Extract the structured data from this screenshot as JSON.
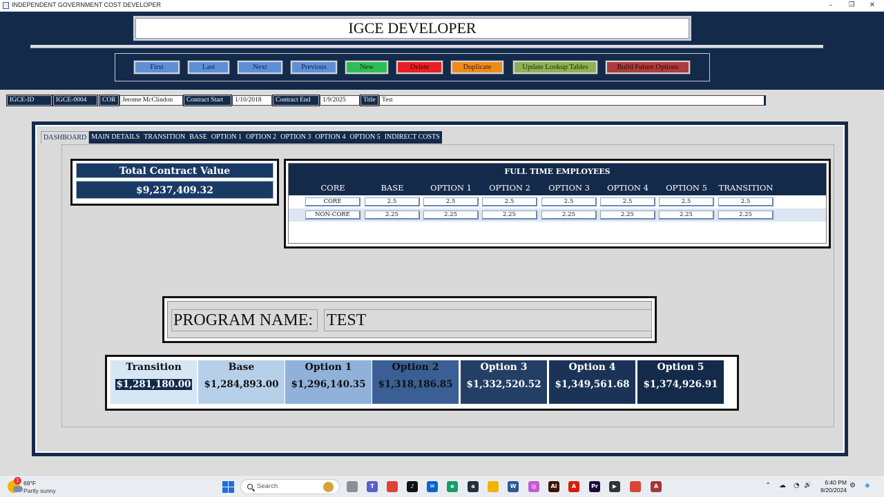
{
  "window": {
    "title": "INDEPENDENT GOVERNMENT COST DEVELOPER",
    "controls": [
      "–",
      "❐",
      "✕"
    ]
  },
  "header": {
    "title": "IGCE DEVELOPER",
    "buttons": [
      {
        "label": "First"
      },
      {
        "label": "Last"
      },
      {
        "label": "Next"
      },
      {
        "label": "Previous"
      },
      {
        "label": "New"
      },
      {
        "label": "Delete"
      },
      {
        "label": "Duplicate"
      },
      {
        "label": "Update Lookup Tables"
      },
      {
        "label": "Build Future Options"
      }
    ]
  },
  "record": {
    "igce_id_label": "IGCE-ID",
    "igce_id_value": "IGCE-0004",
    "cor_label": "COR",
    "cor_value": "Jerome McClindon",
    "contract_start_label": "Contract Start",
    "contract_start_value": "1/10/2018",
    "contract_end_label": "Contract End",
    "contract_end_value": "1/9/2025",
    "title_label": "Title",
    "title_value": "Test"
  },
  "tabs": [
    {
      "label": "DASHBOARD",
      "active": true
    },
    {
      "label": "MAIN DETAILS"
    },
    {
      "label": "TRANSITION"
    },
    {
      "label": "BASE"
    },
    {
      "label": "OPTION 1"
    },
    {
      "label": "OPTION 2"
    },
    {
      "label": "OPTION 3"
    },
    {
      "label": "OPTION 4"
    },
    {
      "label": "OPTION 5"
    },
    {
      "label": "INDIRECT COSTS"
    }
  ],
  "dashboard": {
    "total_contract_value_label": "Total Contract Value",
    "total_contract_value": "$9,237,409.32",
    "fte": {
      "title": "FULL TIME EMPLOYEES",
      "columns": [
        "CORE",
        "BASE",
        "OPTION 1",
        "OPTION 2",
        "OPTION 3",
        "OPTION 4",
        "OPTION 5",
        "TRANSITION"
      ],
      "rows": [
        [
          "CORE",
          "2.5",
          "2.5",
          "2.5",
          "2.5",
          "2.5",
          "2.5",
          "2.5"
        ],
        [
          "NON-CORE",
          "2.25",
          "2.25",
          "2.25",
          "2.25",
          "2.25",
          "2.25",
          "2.25"
        ]
      ]
    },
    "program_name_label": "PROGRAM NAME:",
    "program_name_value": "TEST",
    "period_costs": [
      {
        "label": "Transition",
        "value": "$1,281,180.00",
        "bg": "#d6e6f5",
        "fg": "#111111"
      },
      {
        "label": "Base",
        "value": "$1,284,893.00",
        "bg": "#b7d0ea",
        "fg": "#111111"
      },
      {
        "label": "Option 1",
        "value": "$1,296,140.35",
        "bg": "#8fb1da",
        "fg": "#111111"
      },
      {
        "label": "Option 2",
        "value": "$1,318,186.85",
        "bg": "#3a5f94",
        "fg": "#111111"
      },
      {
        "label": "Option 3",
        "value": "$1,332,520.52",
        "bg": "#243f66",
        "fg": "#ffffff"
      },
      {
        "label": "Option 4",
        "value": "$1,349,561.68",
        "bg": "#1b3356",
        "fg": "#ffffff"
      },
      {
        "label": "Option 5",
        "value": "$1,374,926.91",
        "bg": "#132a4a",
        "fg": "#ffffff"
      }
    ]
  },
  "taskbar": {
    "weather_badge": "1",
    "weather_temp": "69°F",
    "weather_desc": "Partly sunny",
    "search_placeholder": "Search",
    "apps": [
      {
        "icon": "file-explorer-gray-icon",
        "color": "#8a8f98",
        "glyph": ""
      },
      {
        "icon": "teams-icon",
        "color": "#5b5fc7",
        "glyph": "T"
      },
      {
        "icon": "chrome-icon",
        "color": "#db4437",
        "glyph": ""
      },
      {
        "icon": "tiktok-icon",
        "color": "#111111",
        "glyph": "♪"
      },
      {
        "icon": "mail-icon",
        "color": "#0a64c8",
        "glyph": "✉"
      },
      {
        "icon": "edge-icon",
        "color": "#1a9a6a",
        "glyph": "e"
      },
      {
        "icon": "amazon-icon",
        "color": "#232f3e",
        "glyph": "a"
      },
      {
        "icon": "folder-icon",
        "color": "#f0b400",
        "glyph": ""
      },
      {
        "icon": "word-icon",
        "color": "#2b579a",
        "glyph": "W"
      },
      {
        "icon": "paint-icon",
        "color": "#c85ad0",
        "glyph": "◎"
      },
      {
        "icon": "illustrator-icon",
        "color": "#3a1600",
        "glyph": "Ai"
      },
      {
        "icon": "acrobat-icon",
        "color": "#d81e06",
        "glyph": "A"
      },
      {
        "icon": "premiere-icon",
        "color": "#1c0a3a",
        "glyph": "Pr"
      },
      {
        "icon": "media-player-icon",
        "color": "#333333",
        "glyph": "▶"
      },
      {
        "icon": "chrome-profile-icon",
        "color": "#db4437",
        "glyph": ""
      },
      {
        "icon": "access-icon",
        "color": "#a4373a",
        "glyph": "A"
      }
    ],
    "tray": [
      "⌃",
      "☁",
      "◔",
      "🔊"
    ],
    "time": "6:40 PM",
    "date": "8/20/2024"
  }
}
